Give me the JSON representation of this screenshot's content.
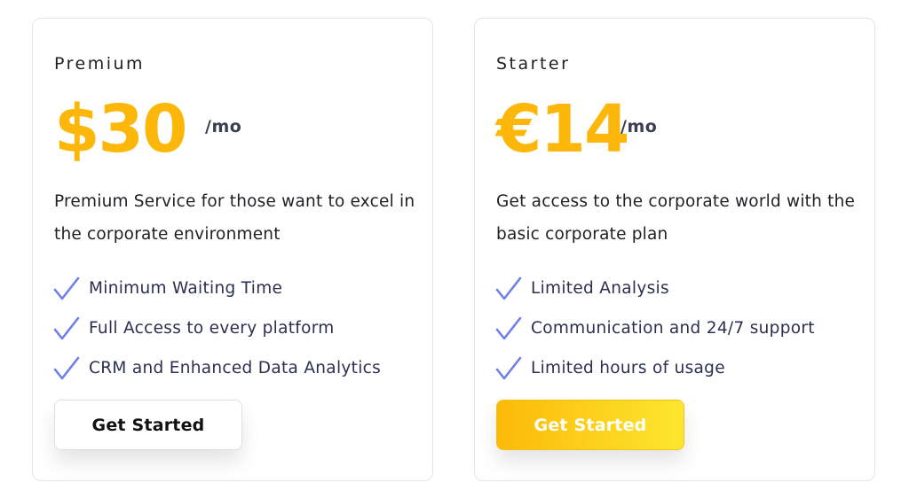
{
  "plans": [
    {
      "name": "Premium",
      "price": "$30",
      "period": "/mo",
      "description": "Premium Service for those want to excel in the corporate environment",
      "features": [
        "Minimum Waiting Time",
        "Full Access to every platform",
        "CRM and Enhanced Data Analytics"
      ],
      "button_label": "Get Started"
    },
    {
      "name": "Starter",
      "price": "€14",
      "period": "/mo",
      "description": "Get access to the corporate world with the basic corporate plan",
      "features": [
        "Limited Analysis",
        "Communication and 24/7 support",
        "Limited hours of usage"
      ],
      "button_label": "Get Started"
    }
  ],
  "colors": {
    "price_accent": "#fcb70a",
    "check_icon": "#6f7fe8",
    "button_gradient_start": "#fbba09",
    "button_gradient_end": "#fde62f"
  },
  "icons": {
    "feature_bullet": "check-icon"
  }
}
